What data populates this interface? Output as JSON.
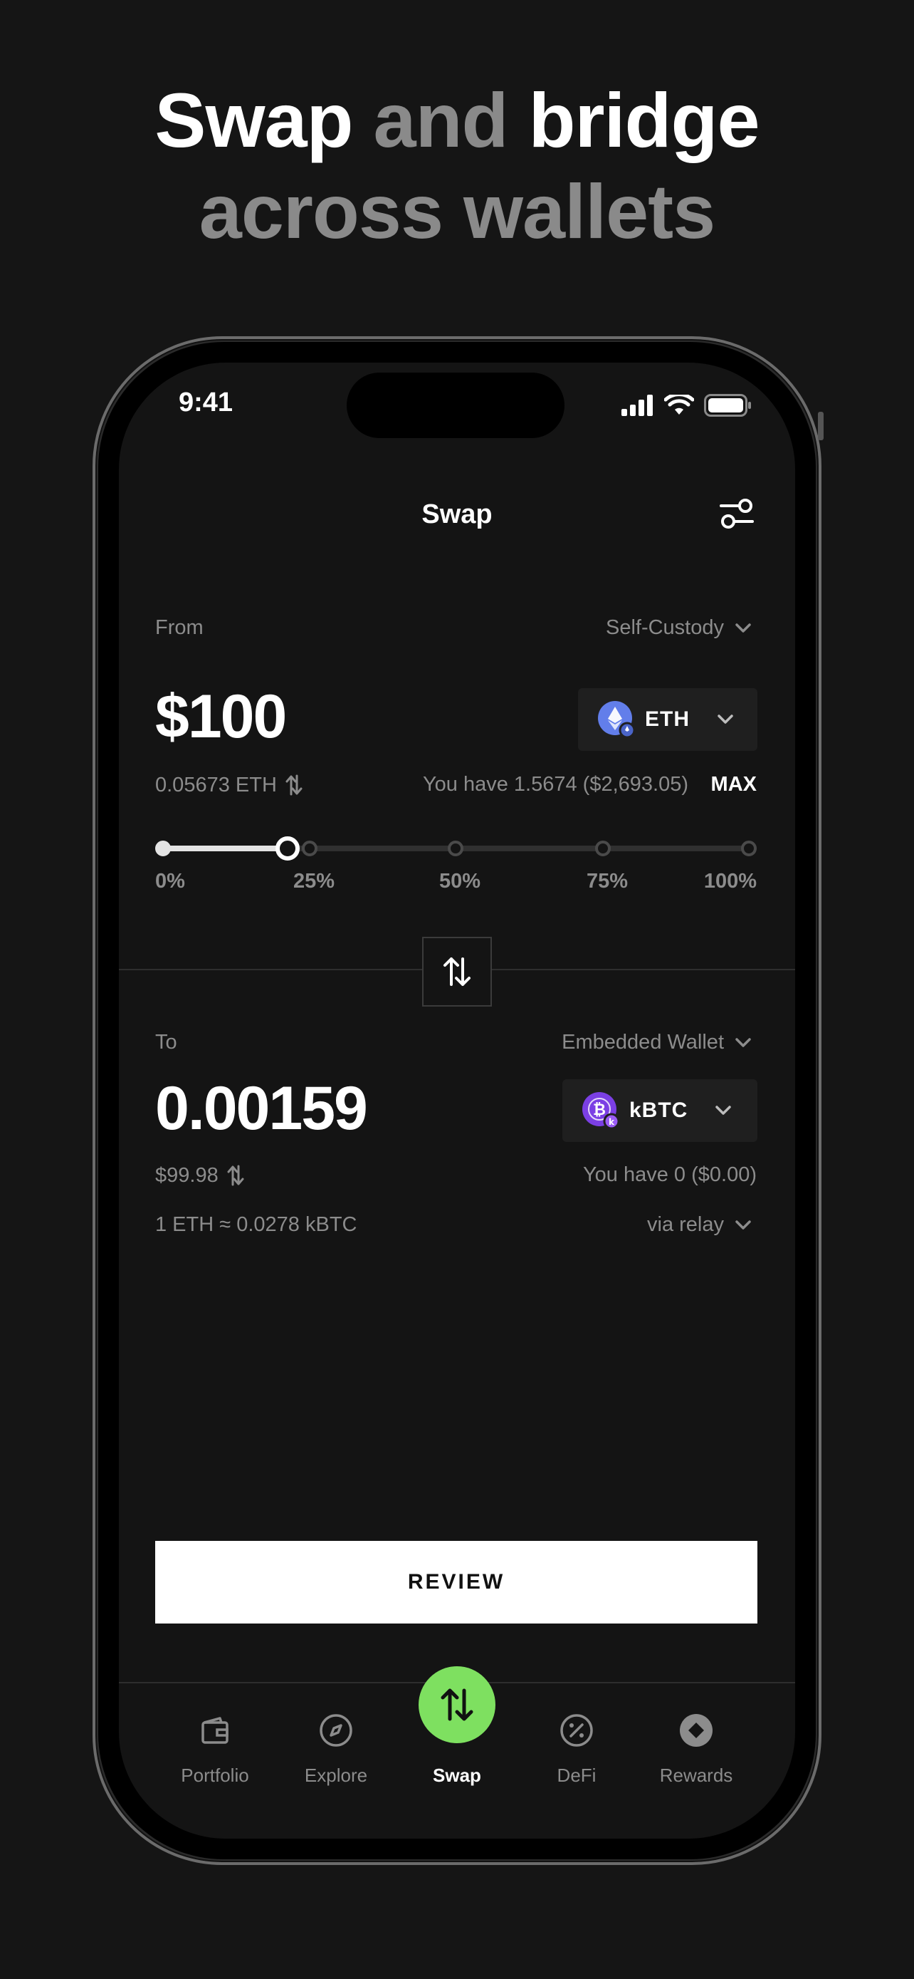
{
  "hero": {
    "line1_part1": "Swap",
    "line1_part2": "and",
    "line1_part3": "bridge",
    "line2": "across wallets"
  },
  "status_bar": {
    "time": "9:41"
  },
  "nav": {
    "title": "Swap"
  },
  "from": {
    "label": "From",
    "wallet": "Self-Custody",
    "amount": "$100",
    "token": "ETH",
    "sub_amount": "0.05673 ETH",
    "balance": "You have 1.5674 ($2,693.05)",
    "max_label": "MAX",
    "slider": {
      "value_percent": 25,
      "marks": [
        "0%",
        "25%",
        "50%",
        "75%",
        "100%"
      ]
    }
  },
  "to": {
    "label": "To",
    "wallet": "Embedded Wallet",
    "amount": "0.00159",
    "token": "kBTC",
    "sub_amount": "$99.98",
    "balance": "You have 0 ($0.00)",
    "rate": "1 ETH ≈ 0.0278 kBTC",
    "route": "via relay"
  },
  "review_label": "REVIEW",
  "tabs": [
    {
      "label": "Portfolio",
      "icon": "wallet-icon"
    },
    {
      "label": "Explore",
      "icon": "compass-icon"
    },
    {
      "label": "Swap",
      "icon": "swap-arrows-icon"
    },
    {
      "label": "DeFi",
      "icon": "percent-icon"
    },
    {
      "label": "Rewards",
      "icon": "diamond-icon"
    }
  ],
  "colors": {
    "background": "#151515",
    "screen": "#141414",
    "accent_green": "#7ee060",
    "muted_text": "#8c8c8c",
    "eth_icon": "#627eea",
    "kbtc_icon": "#7b3fe4"
  }
}
